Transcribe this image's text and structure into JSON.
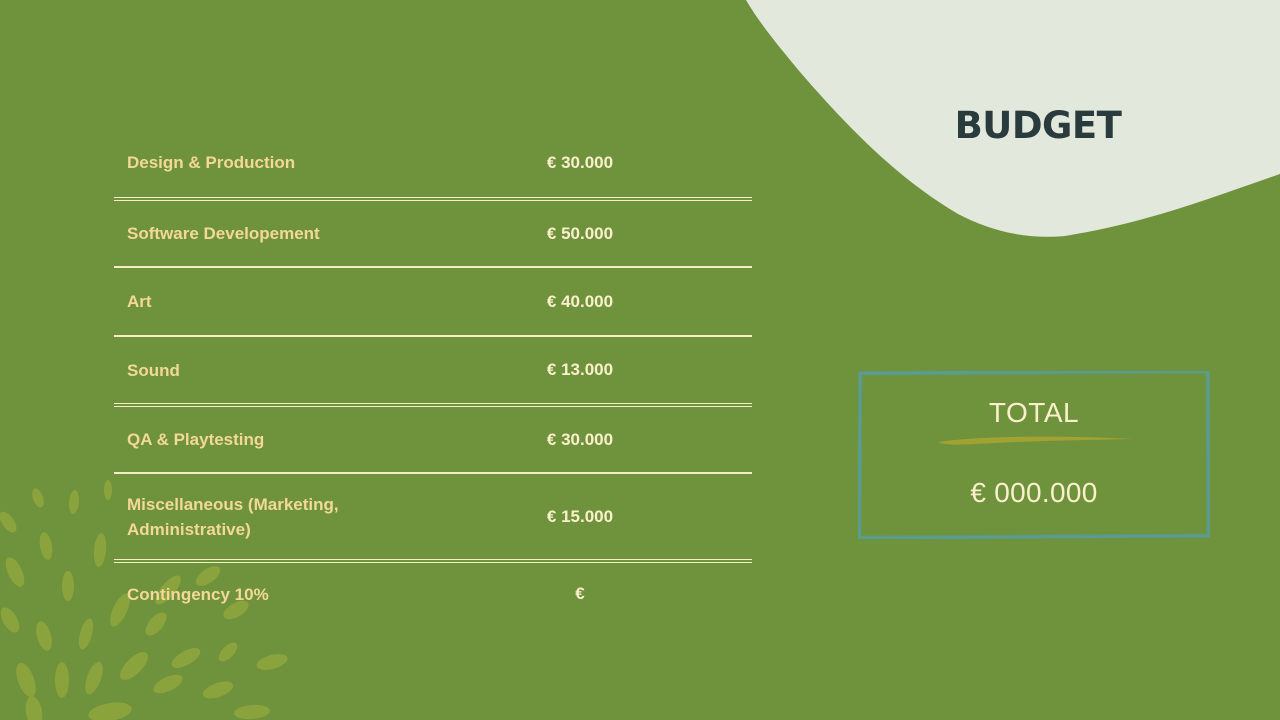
{
  "slide": {
    "title": "BUDGET"
  },
  "budget_rows": [
    {
      "label": "Design & Production",
      "value": "€ 30.000"
    },
    {
      "label": "Software Developement",
      "value": "€ 50.000"
    },
    {
      "label": "Art",
      "value": "€ 40.000"
    },
    {
      "label": "Sound",
      "value": "€ 13.000"
    },
    {
      "label": "QA & Playtesting",
      "value": "€ 30.000"
    },
    {
      "label": "Miscellaneous (Marketing, Administrative)",
      "value": "€ 15.000"
    },
    {
      "label": "Contingency 10%",
      "value": "€"
    }
  ],
  "total": {
    "label": "TOTAL",
    "amount": "€ 000.000"
  },
  "colors": {
    "background": "#6f923c",
    "blob": "#e3e8dc",
    "title": "#2a3b3e",
    "row_label": "#f3d89a",
    "row_value": "#fbf0cc",
    "frame": "#5a9c93",
    "accent_stroke": "#a2a233",
    "leaf_decoration": "#8fa73c"
  }
}
